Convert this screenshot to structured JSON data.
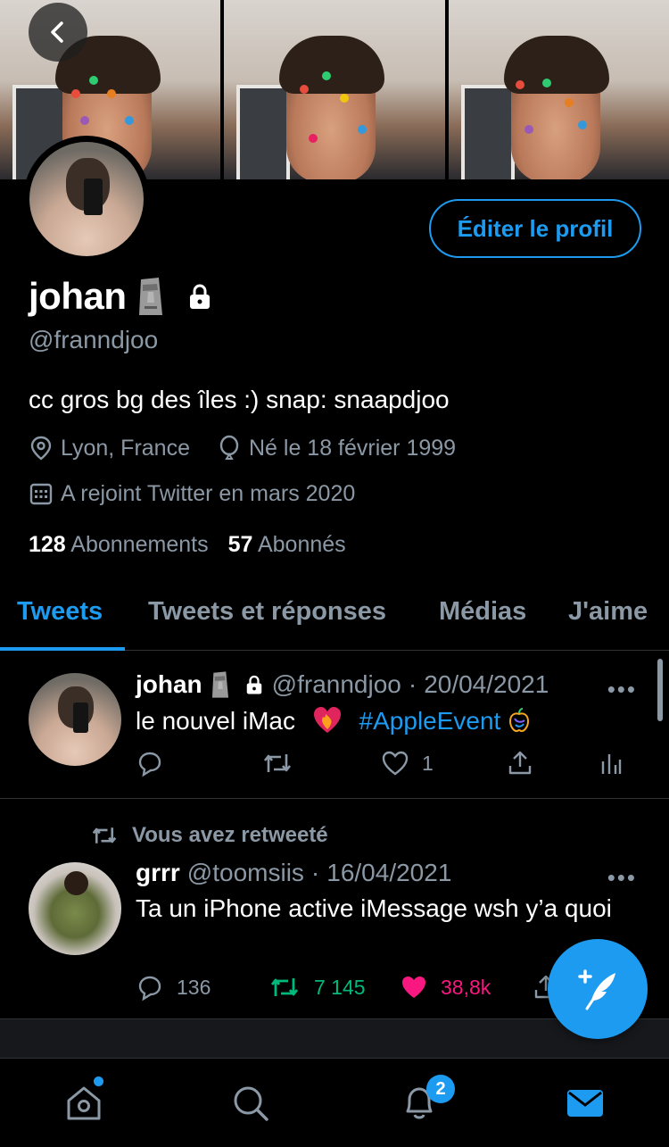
{
  "profile": {
    "name": "johan",
    "name_emoji": "moai",
    "handle": "@franndjoo",
    "bio": "cc gros bg des îles :) snap: snaapdjoo",
    "location": "Lyon, France",
    "birthday": "Né le 18 février 1999",
    "joined": "A rejoint Twitter en mars 2020",
    "following_count": "128",
    "following_label": "Abonnements",
    "followers_count": "57",
    "followers_label": "Abonnés",
    "edit_button_label": "Éditer le profil",
    "protected": true
  },
  "tabs": [
    {
      "label": "Tweets",
      "active": true
    },
    {
      "label": "Tweets et réponses",
      "active": false
    },
    {
      "label": "Médias",
      "active": false
    },
    {
      "label": "J'aime",
      "active": false
    }
  ],
  "tweets": [
    {
      "author": "johan",
      "handle": "@franndjoo",
      "separator": "·",
      "date": "20/04/2021",
      "text": "le nouvel iMac",
      "hashtag": "#AppleEvent",
      "more": "•••",
      "counts": {
        "reply": "",
        "retweet": "",
        "like": "1"
      },
      "retweeted_by_you": false
    },
    {
      "retweet_label": "Vous avez retweeté",
      "author": "grrr",
      "handle": "@toomsiis",
      "separator": "·",
      "date": "16/04/2021",
      "text": "Ta un iPhone active iMessage wsh y’a quoi",
      "more": "•••",
      "counts": {
        "reply": "136",
        "retweet": "7 145",
        "like": "38,8k"
      },
      "retweeted_by_you": true,
      "liked": true
    }
  ],
  "nav": {
    "items": [
      "home-icon",
      "search-icon",
      "bell-icon",
      "mail-icon"
    ],
    "notification_badge": "2",
    "active": "mail-icon"
  },
  "colors": {
    "accent": "#1d9bf0",
    "retweet_green": "#00ba7c",
    "like_red": "#f91880",
    "muted": "#8b98a5",
    "background": "#000000"
  }
}
